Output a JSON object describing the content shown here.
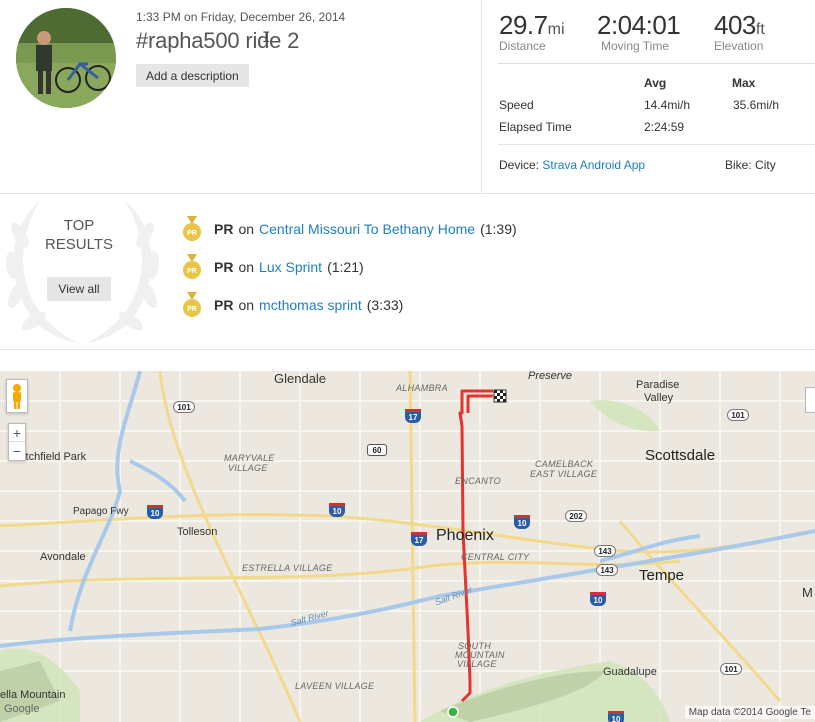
{
  "activity": {
    "datetime": "1:33 PM on Friday, December 26, 2014",
    "title": "#rapha500 ride 2",
    "cursor_glyph": "I",
    "add_description_label": "Add a description"
  },
  "stats": {
    "distance": {
      "value": "29.7",
      "unit": "mi",
      "label": "Distance"
    },
    "moving_time": {
      "value": "2:04:01",
      "label": "Moving Time"
    },
    "elevation": {
      "value": "403",
      "unit": "ft",
      "label": "Elevation"
    },
    "table": {
      "avg_header": "Avg",
      "max_header": "Max",
      "rows": [
        {
          "label": "Speed",
          "avg": "14.4mi/h",
          "max": "35.6mi/h"
        },
        {
          "label": "Elapsed Time",
          "avg": "2:24:59",
          "max": ""
        }
      ]
    },
    "device_label": "Device:",
    "device_value": "Strava Android App",
    "bike_label": "Bike:",
    "bike_value": "City"
  },
  "top_results": {
    "title_line1": "TOP",
    "title_line2": "RESULTS",
    "view_all_label": "View all",
    "items": [
      {
        "badge": "PR",
        "prefix": "PR",
        "on": "on",
        "segment": "Central Missouri To Bethany Home",
        "time": "(1:39)"
      },
      {
        "badge": "PR",
        "prefix": "PR",
        "on": "on",
        "segment": "Lux Sprint",
        "time": "(1:21)"
      },
      {
        "badge": "PR",
        "prefix": "PR",
        "on": "on",
        "segment": "mcthomas sprint",
        "time": "(3:33)"
      }
    ]
  },
  "map": {
    "labels": {
      "glendale": "Glendale",
      "alhambra": "ALHAMBRA",
      "preserve": "Preserve",
      "paradise_valley_1": "Paradise",
      "paradise_valley_2": "Valley",
      "scottsdale": "Scottsdale",
      "litchfield": "Litchfield Park",
      "maryvale_1": "MARYVALE",
      "maryvale_2": "VILLAGE",
      "encanto": "ENCANTO",
      "camelback_1": "CAMELBACK",
      "camelback_2": "EAST VILLAGE",
      "papago": "Papago Fwy",
      "tolleson": "Tolleson",
      "phoenix": "Phoenix",
      "central_city": "CENTRAL CITY",
      "avondale": "Avondale",
      "estrella": "ESTRELLA VILLAGE",
      "tempe": "Tempe",
      "salt_river_1": "Salt River",
      "salt_river_2": "Salt River",
      "south_mountain_1": "SOUTH",
      "south_mountain_2": "MOUNTAIN",
      "south_mountain_3": "VILLAGE",
      "laveen": "LAVEEN VILLAGE",
      "guadalupe": "Guadalupe",
      "estrella_mountain": "ella Mountain",
      "google": "Google",
      "edge_m": "M"
    },
    "shields": {
      "i17a": "17",
      "i17b": "17",
      "i10a": "10",
      "i10b": "10",
      "i10c": "10",
      "i10d": "10",
      "i10e": "10",
      "us60": "60",
      "s101a": "101",
      "s101b": "101",
      "s101c": "101",
      "s202": "202",
      "s143a": "143",
      "s143b": "143"
    },
    "zoom_in": "+",
    "zoom_out": "−",
    "attribution": "Map data ©2014 Google   Te"
  },
  "colors": {
    "link": "#1e7ec0",
    "route": "#e5332f",
    "medal": "#e8c547",
    "water": "#a9c9ea"
  }
}
